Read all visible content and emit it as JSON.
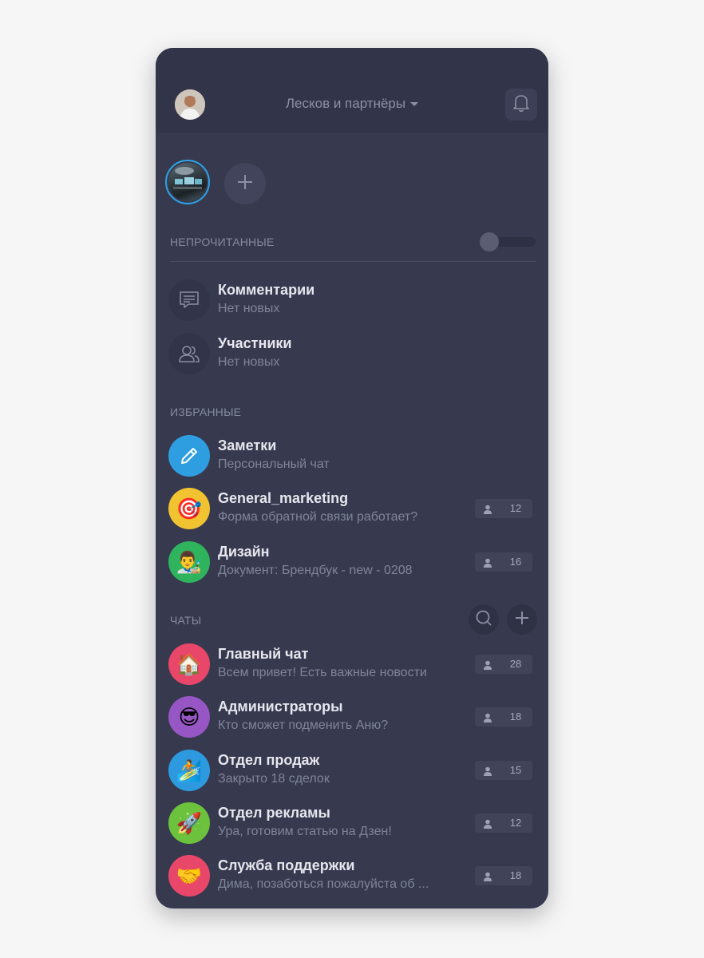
{
  "header": {
    "workspace_title": "Лесков и партнёры",
    "user_avatar_icon": "user-photo",
    "bell_icon": "bell-icon"
  },
  "workspaces": {
    "active_icon": "workspace-photo",
    "add_icon": "plus-icon"
  },
  "unread": {
    "label": "НЕПРОЧИТАННЫЕ",
    "toggle_on": false,
    "items": [
      {
        "title": "Комментарии",
        "subtitle": "Нет новых",
        "icon": "comment-icon"
      },
      {
        "title": "Участники",
        "subtitle": "Нет новых",
        "icon": "users-icon"
      }
    ]
  },
  "favorites": {
    "label": "ИЗБРАННЫЕ",
    "items": [
      {
        "title": "Заметки",
        "subtitle": "Персональный чат",
        "icon": "pencil-icon",
        "color": "#2e9ee0"
      },
      {
        "title": "General_marketing",
        "subtitle": "Форма обратной связи работает?",
        "icon": "🎯",
        "color": "#f2c330",
        "members": "12"
      },
      {
        "title": "Дизайн",
        "subtitle": "Документ: Брендбук - new - 0208",
        "icon": "👨‍🎨",
        "color": "#2fb45d",
        "members": "16"
      }
    ]
  },
  "chats": {
    "label": "ЧАТЫ",
    "search_icon": "search-icon",
    "add_icon": "plus-icon",
    "items": [
      {
        "title": "Главный чат",
        "subtitle": "Всем привет! Есть важные новости",
        "icon": "🏠",
        "color": "#e9476a",
        "members": "28"
      },
      {
        "title": "Администраторы",
        "subtitle": "Кто сможет подменить Аню?",
        "icon": "😎",
        "color": "#9656c4",
        "members": "18"
      },
      {
        "title": "Отдел продаж",
        "subtitle": "Закрыто 18 сделок",
        "icon": "🏄",
        "color": "#2d9ae0",
        "members": "15"
      },
      {
        "title": "Отдел рекламы",
        "subtitle": "Ура, готовим статью на Дзен!",
        "icon": "🚀",
        "color": "#6cc23c",
        "members": "12"
      },
      {
        "title": "Служба поддержки",
        "subtitle": "Дима, позаботься пожалуйста об ...",
        "icon": "🤝",
        "color": "#e9476a",
        "members": "18"
      }
    ]
  },
  "colors": {
    "background": "#373a4f",
    "header": "#32344a",
    "accent": "#2ea3e6"
  }
}
